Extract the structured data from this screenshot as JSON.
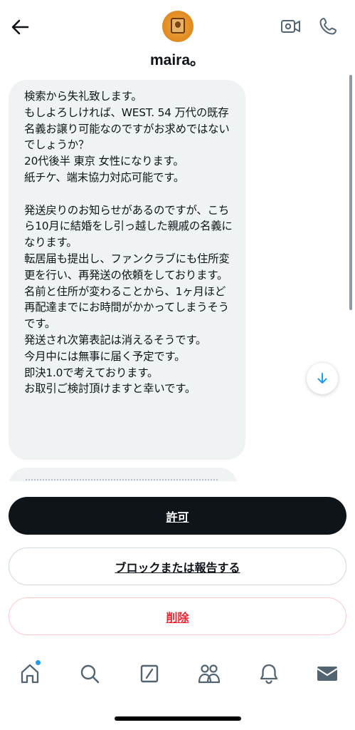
{
  "header": {
    "username": "maira。",
    "icons": [
      "back-arrow-icon",
      "video-call-icon",
      "phone-icon"
    ]
  },
  "message": {
    "text": "検索から失礼致します。\nもしよろしければ、WEST. 54 万代の既存名義お譲り可能なのですがお求めではないでしょうか？\n20代後半 東京 女性になります。\n紙チケ、端末協力対応可能です。\n\n発送戻りのお知らせがあるのですが、こちら10月に結婚をし引っ越した親戚の名義になります。\n転居届も提出し、ファンクラブにも住所変更を行い、再発送の依頼をしております。\n名前と住所が変わることから、1ヶ月ほど再配達までにお時間がかかってしまうそうです。\n発送され次第表記は消えるそうです。\n今月中には無事に届く予定です。\n即決1.0で考えております。\nお取引ご検討頂けますと幸いです。"
  },
  "actions": {
    "allow": "許可",
    "block_report": "ブロックまたは報告する",
    "delete": "削除"
  },
  "nav": {
    "items": [
      "home-icon",
      "search-icon",
      "compose-icon",
      "communities-icon",
      "notifications-icon",
      "messages-icon"
    ]
  },
  "colors": {
    "primary_button": "#0f1419",
    "delete_red": "#f4212e",
    "badge_blue": "#1d9bf0",
    "bubble_gray": "#eff3f4"
  }
}
